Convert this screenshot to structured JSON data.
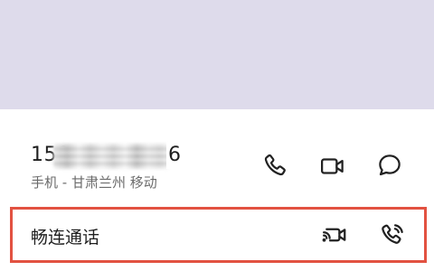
{
  "contact": {
    "number_head": "150",
    "number_tail": "6",
    "location": "手机 - 甘肃兰州 移动"
  },
  "changlian": {
    "label": "畅连通话"
  },
  "colors": {
    "header_band": "#dedbeb",
    "highlight_border": "#e25241",
    "text_primary": "#1f1f1f",
    "text_secondary": "#6b6b6b"
  },
  "icons": {
    "call": "phone-icon",
    "video": "video-camera-icon",
    "message": "message-bubble-icon",
    "changlian_video": "changlian-video-icon",
    "changlian_call": "changlian-phone-icon"
  }
}
